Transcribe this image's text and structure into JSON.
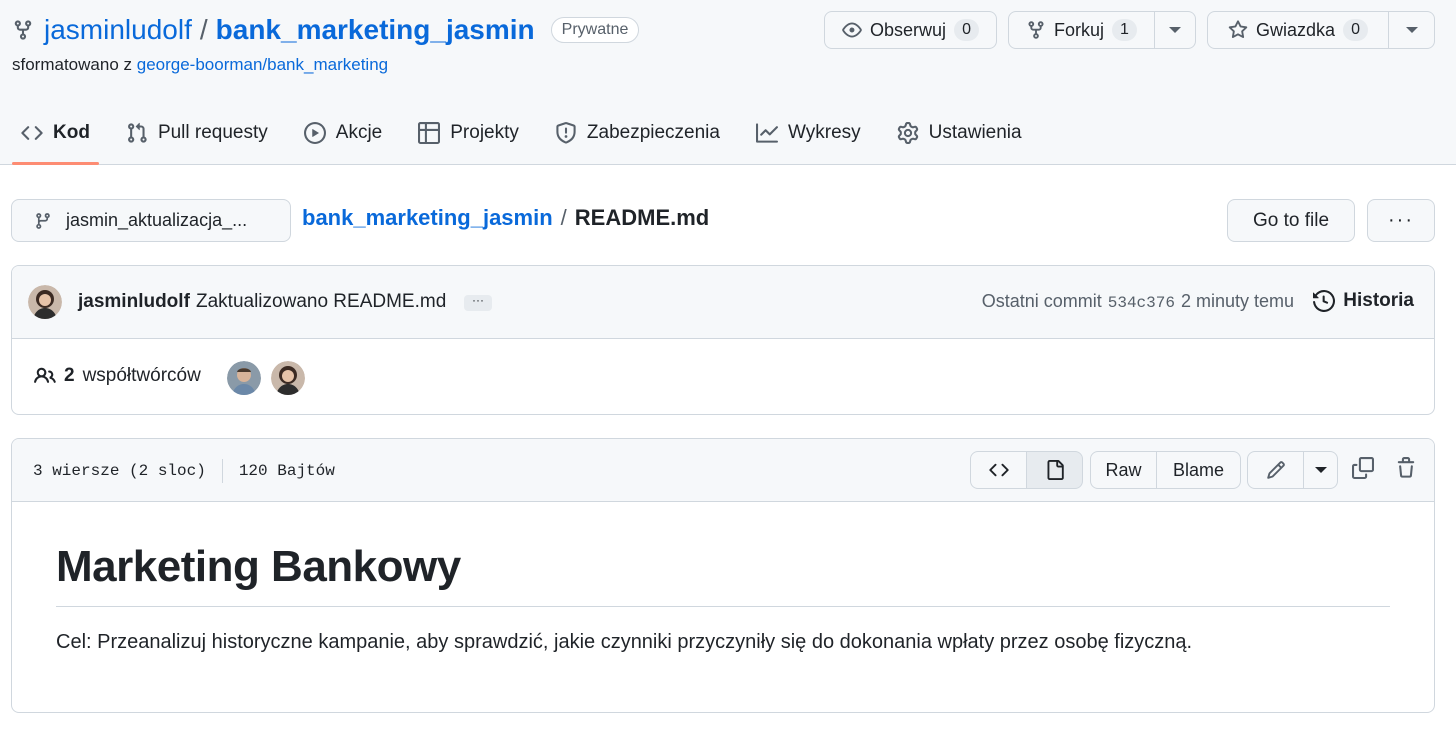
{
  "repo": {
    "owner": "jasminludolf",
    "separator": "/",
    "name": "bank_marketing_jasmin",
    "visibility": "Prywatne",
    "forked_prefix": "sformatowano z",
    "forked_source": "george-boorman/bank_marketing"
  },
  "actions": {
    "watch_label": "Obserwuj",
    "watch_count": "0",
    "fork_label": "Forkuj",
    "fork_count": "1",
    "star_label": "Gwiazdka",
    "star_count": "0"
  },
  "nav": {
    "items": [
      {
        "label": "Kod",
        "icon": "code-icon"
      },
      {
        "label": "Pull requesty",
        "icon": "pull-request-icon"
      },
      {
        "label": "Akcje",
        "icon": "play-icon"
      },
      {
        "label": "Projekty",
        "icon": "table-icon"
      },
      {
        "label": "Zabezpieczenia",
        "icon": "shield-icon"
      },
      {
        "label": "Wykresy",
        "icon": "graph-icon"
      },
      {
        "label": "Ustawienia",
        "icon": "gear-icon"
      }
    ],
    "active_index": 0
  },
  "file_nav": {
    "branch": "jasmin_aktualizacja_...",
    "path_repo": "bank_marketing_jasmin",
    "path_sep": "/",
    "path_file": "README.md",
    "goto_label": "Go to file",
    "more_label": "···"
  },
  "commit": {
    "author": "jasminludolf",
    "message": "Zaktualizowano README.md",
    "ellipsis": "···",
    "last_commit_label": "Ostatni commit",
    "sha": "534c376",
    "time": "2 minuty temu",
    "history_label": "Historia"
  },
  "contributors": {
    "count": "2",
    "label": "współtwórców"
  },
  "file": {
    "lines": "3 wiersze (2 sloc)",
    "size": "120 Bajtów",
    "raw_label": "Raw",
    "blame_label": "Blame"
  },
  "readme": {
    "heading": "Marketing Bankowy",
    "paragraph": "Cel: Przeanalizuj historyczne kampanie, aby sprawdzić, jakie czynniki przyczyniły się do dokonania wpłaty przez osobę fizyczną."
  },
  "colors": {
    "link": "#0969da",
    "nav_underline": "#fd8c73",
    "border": "#d0d7de",
    "header_bg": "#f6f8fa"
  }
}
